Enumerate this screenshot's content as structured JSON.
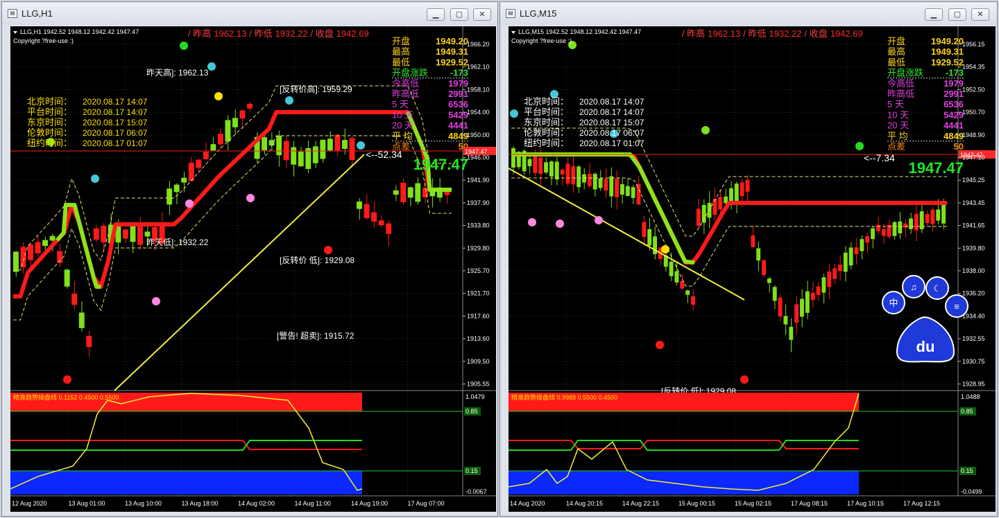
{
  "windows": [
    {
      "title": "LLG,H1",
      "header": "LLG,H1  1942.52 1948.12 1942.42 1947.47",
      "copyright": "Copyright ?free-use :)",
      "top_info": {
        "prev_high_label": "/ 昨高",
        "prev_high": "1962.13",
        "prev_low_label": "/ 昨低",
        "prev_low": "1932.22",
        "close_label": "/ 收盘",
        "close": "1942.69"
      },
      "stats": [
        {
          "label": "开盘",
          "value": "1949.20",
          "color": "#ffd21a"
        },
        {
          "label": "最高",
          "value": "1949.31",
          "color": "#ffd21a"
        },
        {
          "label": "最低",
          "value": "1929.52",
          "color": "#ffd21a"
        },
        {
          "label": "开盘涨跌",
          "value": "-173",
          "color": "#32e632"
        },
        {
          "label": "今高低",
          "value": "1979",
          "color": "#e040e0"
        },
        {
          "label": "昨高低",
          "value": "2991",
          "color": "#e040e0"
        },
        {
          "label": "5  天",
          "value": "6536",
          "color": "#e040e0"
        },
        {
          "label": "10  天",
          "value": "5429",
          "color": "#e040e0"
        },
        {
          "label": "20  天",
          "value": "4441",
          "color": "#e040e0"
        },
        {
          "label": "平  均",
          "value": "4849",
          "color": "#ffd21a"
        },
        {
          "label": "点差",
          "value": "50",
          "color": "#ff8c00"
        }
      ],
      "times": [
        {
          "label": "北京时间：",
          "value": "2020.08.17 14:07"
        },
        {
          "label": "平台时间：",
          "value": "2020.08.17 14:07"
        },
        {
          "label": "东京时间：",
          "value": "2020.08.17 15:07"
        },
        {
          "label": "伦敦时间：",
          "value": "2020.08.17 06:07"
        },
        {
          "label": "纽约时间：",
          "value": "2020.08.17 01:07"
        }
      ],
      "annotations": [
        "昨天高]: 1962.13",
        "[反转价高]: 1959.29",
        "昨天低]: 1932.22",
        "[反转价 低]: 1929.08",
        "[警告!  超卖]: 1915.72"
      ],
      "diff": "<--52.34",
      "big_price": "1947.47",
      "price_tag": "1947.47",
      "y_ticks": [
        "1966.20",
        "1962.10",
        "1958.10",
        "1954.00",
        "1950.00",
        "1946.00",
        "1941.90",
        "1937.90",
        "1933.80",
        "1929.80",
        "1925.70",
        "1921.70",
        "1917.60",
        "1913.60",
        "1909.50",
        "1905.55"
      ],
      "indicator_label": "精准趋势操盘线 0.1152 0.4500 0.5500",
      "ind_ticks": [
        "1.0479",
        "0.85",
        "0.15",
        "-0.0067"
      ],
      "x_ticks": [
        "12 Aug 2020",
        "13 Aug 01:00",
        "13 Aug 10:00",
        "13 Aug 18:00",
        "14 Aug 02:00",
        "14 Aug 11:00",
        "14 Aug 19:00",
        "17 Aug 07:00"
      ]
    },
    {
      "title": "LLG,M15",
      "header": "LLG,M15  1942.52 1948.12 1942.42 1947.47",
      "copyright": "Copyright ?free-use :)",
      "top_info": {
        "prev_high_label": "/ 昨高",
        "prev_high": "1962.13",
        "prev_low_label": "/ 昨低",
        "prev_low": "1932.22",
        "close_label": "/ 收盘",
        "close": "1942.69"
      },
      "stats": [
        {
          "label": "开盘",
          "value": "1949.20",
          "color": "#ffd21a"
        },
        {
          "label": "最高",
          "value": "1949.31",
          "color": "#ffd21a"
        },
        {
          "label": "最低",
          "value": "1929.52",
          "color": "#ffd21a"
        },
        {
          "label": "开盘涨跌",
          "value": "-173",
          "color": "#32e632"
        },
        {
          "label": "今高低",
          "value": "1979",
          "color": "#e040e0"
        },
        {
          "label": "昨高低",
          "value": "2991",
          "color": "#e040e0"
        },
        {
          "label": "5  天",
          "value": "6536",
          "color": "#e040e0"
        },
        {
          "label": "10  天",
          "value": "5429",
          "color": "#e040e0"
        },
        {
          "label": "20  天",
          "value": "4441",
          "color": "#e040e0"
        },
        {
          "label": "平  均",
          "value": "4849",
          "color": "#ffd21a"
        },
        {
          "label": "点差",
          "value": "50",
          "color": "#ff8c00"
        }
      ],
      "times": [
        {
          "label": "北京时间：",
          "value": "2020.08.17 14:07"
        },
        {
          "label": "平台时间：",
          "value": "2020.08.17 14:07"
        },
        {
          "label": "东京时间：",
          "value": "2020.08.17 15:07"
        },
        {
          "label": "伦敦时间：",
          "value": "2020.08.17 06:07"
        },
        {
          "label": "纽约时间：",
          "value": "2020.08.17 01:07"
        }
      ],
      "annotations": [
        "[反转价 低]: 1929.08"
      ],
      "diff": "<--7.34",
      "big_price": "1947.47",
      "price_tag": "1947.47",
      "y_ticks": [
        "1956.15",
        "1954.35",
        "1952.50",
        "1950.70",
        "1948.90",
        "1947.10",
        "1945.25",
        "1943.45",
        "1941.65",
        "1939.80",
        "1938.00",
        "1936.20",
        "1934.40",
        "1932.55",
        "1930.75",
        "1928.95"
      ],
      "indicator_label": "精准趋势操盘线 0.9988 0.5500 0.4500",
      "ind_ticks": [
        "1.0488",
        "0.85",
        "0.15",
        "-0.0499"
      ],
      "x_ticks": [
        "14 Aug 2020",
        "14 Aug 20:15",
        "14 Aug 22:15",
        "15 Aug 00:15",
        "15 Aug 02:15",
        "17 Aug 08:15",
        "17 Aug 10:15",
        "17 Aug 12:15"
      ]
    }
  ],
  "logo_text": "du",
  "logo_glyphs": [
    "中",
    "♫",
    "☾",
    "≡"
  ]
}
